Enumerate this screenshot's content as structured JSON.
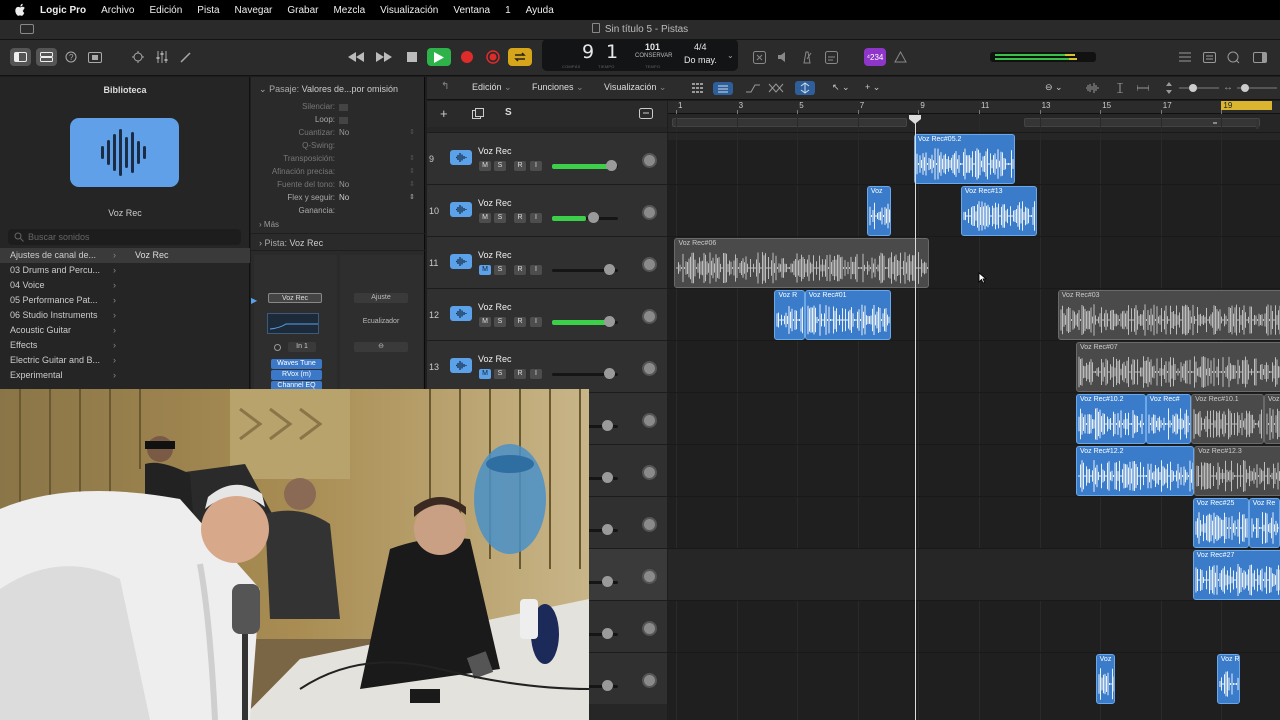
{
  "menubar": {
    "app": "Logic Pro",
    "items": [
      "Archivo",
      "Edición",
      "Pista",
      "Navegar",
      "Grabar",
      "Mezcla",
      "Visualización",
      "Ventana",
      "1",
      "Ayuda"
    ]
  },
  "window": {
    "title": "Sin título 5 - Pistas"
  },
  "lcd": {
    "bar": "9",
    "beat": "1",
    "bar_label": "COMPÁS",
    "beat_label": "TIEMPO",
    "tempo": "101",
    "tempo_mode": "CONSERVAR",
    "tempo_label": "TEMPO",
    "signature": "4/4",
    "key": "Do may."
  },
  "badge": "⁴234",
  "library": {
    "title": "Biblioteca",
    "patch_name": "Voz Rec",
    "search_placeholder": "Buscar sonidos",
    "items": [
      "Ajustes de canal de...",
      "03 Drums and Percu...",
      "04 Voice",
      "05 Performance Pat...",
      "06 Studio Instruments",
      "Acoustic Guitar",
      "Effects",
      "Electric Guitar and B...",
      "Experimental"
    ],
    "selected_right": "Voz Rec"
  },
  "inspector": {
    "region_header": "Pasaje:",
    "region_value": "Valores de...por omisión",
    "rows": [
      {
        "label": "Silenciar:",
        "value": ""
      },
      {
        "label": "Loop:",
        "value": ""
      },
      {
        "label": "Cuantizar:",
        "value": "No"
      },
      {
        "label": "Q-Swing:",
        "value": ""
      },
      {
        "label": "Transposición:",
        "value": ""
      },
      {
        "label": "Afinación precisa:",
        "value": ""
      },
      {
        "label": "Fuente del tono:",
        "value": "No"
      },
      {
        "label": "Flex y seguir:",
        "value": "No"
      },
      {
        "label": "Ganancia:",
        "value": ""
      }
    ],
    "more": "Más",
    "track_header": "Pista:",
    "track_value": "Voz Rec",
    "strip_name": "Voz Rec",
    "strip_setting": "Ajuste",
    "eq_label": "Ecualizador",
    "input": "In 1",
    "plugins": [
      "Waves Tune",
      "RVox (m)",
      "Channel EQ"
    ]
  },
  "tracks_bar": {
    "menus": [
      "Edición",
      "Funciones",
      "Visualización"
    ]
  },
  "track_list_s": "S",
  "tracks": [
    {
      "num": "9",
      "name": "Voz Rec",
      "m": "M",
      "s": "S",
      "r": "R",
      "i": "I",
      "level": 0.88,
      "mute": false
    },
    {
      "num": "10",
      "name": "Voz Rec",
      "m": "M",
      "s": "S",
      "r": "R",
      "i": "I",
      "level": 0.52,
      "mute": false
    },
    {
      "num": "11",
      "name": "Voz Rec",
      "m": "M",
      "s": "S",
      "r": "R",
      "i": "I",
      "level": 0.0,
      "mute": true
    },
    {
      "num": "12",
      "name": "Voz Rec",
      "m": "M",
      "s": "S",
      "r": "R",
      "i": "I",
      "level": 0.84,
      "mute": false
    },
    {
      "num": "13",
      "name": "Voz Rec",
      "m": "M",
      "s": "S",
      "r": "R",
      "i": "I",
      "level": 0.0,
      "mute": true
    }
  ],
  "ruler": [
    "1",
    "3",
    "5",
    "7",
    "9",
    "11",
    "13",
    "15",
    "17",
    "19"
  ],
  "regions": [
    {
      "name": "Voz Rec#05.2",
      "lane": 0,
      "start": 8.85,
      "end": 12.2,
      "color": "blue"
    },
    {
      "name": "Voz",
      "lane": 1,
      "start": 7.3,
      "end": 8.1,
      "color": "blue"
    },
    {
      "name": "Voz Rec#13",
      "lane": 1,
      "start": 10.4,
      "end": 12.9,
      "color": "blue"
    },
    {
      "name": "Voz Rec#06",
      "lane": 2,
      "start": 0.95,
      "end": 9.35,
      "color": "gray"
    },
    {
      "name": "Voz R",
      "lane": 3,
      "start": 4.25,
      "end": 5.25,
      "color": "blue"
    },
    {
      "name": "Voz Rec#01",
      "lane": 3,
      "start": 5.25,
      "end": 8.1,
      "color": "blue"
    },
    {
      "name": "Voz Rec#03",
      "lane": 3,
      "start": 13.6,
      "end": 22.4,
      "color": "gray"
    },
    {
      "name": "Voz Rec#07",
      "lane": 4,
      "start": 14.2,
      "end": 22.4,
      "color": "gray"
    },
    {
      "name": "Voz Rec#10.2",
      "lane": 5,
      "start": 14.2,
      "end": 16.5,
      "color": "blue"
    },
    {
      "name": "Voz Rec#",
      "lane": 5,
      "start": 16.5,
      "end": 18.0,
      "color": "blue"
    },
    {
      "name": "Voz Rec#10.1",
      "lane": 5,
      "start": 18.0,
      "end": 20.4,
      "color": "gray"
    },
    {
      "name": "Voz Re",
      "lane": 5,
      "start": 20.4,
      "end": 21.9,
      "color": "gray"
    },
    {
      "name": "Voz Rec#12.2",
      "lane": 6,
      "start": 14.2,
      "end": 18.1,
      "color": "blue"
    },
    {
      "name": "Voz Rec#12.3",
      "lane": 6,
      "start": 18.1,
      "end": 22.1,
      "color": "gray"
    },
    {
      "name": "Voz Rec#25",
      "lane": 7,
      "start": 18.05,
      "end": 19.9,
      "color": "blue"
    },
    {
      "name": "Voz Re",
      "lane": 7,
      "start": 19.9,
      "end": 20.95,
      "color": "blue"
    },
    {
      "name": "Voz Re",
      "lane": 7,
      "start": 20.95,
      "end": 21.9,
      "color": "blue"
    },
    {
      "name": "Voz Rec#27",
      "lane": 8,
      "start": 18.05,
      "end": 22.2,
      "color": "blue"
    },
    {
      "name": "Voz",
      "lane": 10,
      "start": 14.85,
      "end": 15.5,
      "color": "blue"
    },
    {
      "name": "Voz R",
      "lane": 10,
      "start": 18.85,
      "end": 19.6,
      "color": "blue"
    }
  ],
  "colors": {
    "region_blue": "#3a7cc9",
    "accent_green": "#28a745",
    "accent_purple": "#8a2be2"
  }
}
